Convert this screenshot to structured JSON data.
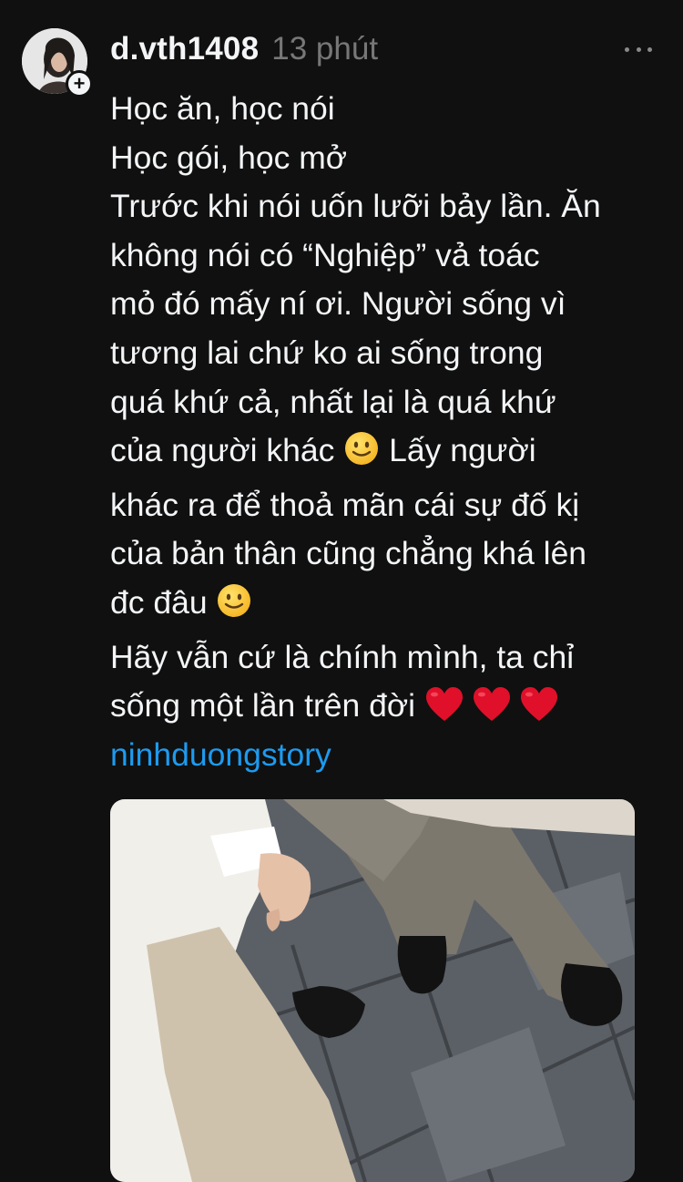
{
  "post": {
    "author": {
      "username": "d.vth1408",
      "timestamp": "13 phút",
      "follow_symbol": "+"
    },
    "text_lines": [
      "Học ăn, học nói",
      "Học gói, học mở",
      "Trước khi nói uốn lưỡi bảy lần. Ăn",
      "không nói có “Nghiệp” vả toác",
      "mỏ đó mấy ní ơi. Người sống vì",
      "tương lai chứ ko ai sống trong",
      "quá khứ cả, nhất lại là quá khứ"
    ],
    "line8_before": "của người khác ",
    "line8_after": " Lấy người",
    "line9": "khác ra để thoả mãn cái sự đố kị",
    "line10": "của bản thân cũng chẳng khá lên",
    "line11_before": "đc đâu ",
    "line12": "Hãy vẫn cứ là chính mình, ta chỉ",
    "line13_before": "sống một lần trên đời ",
    "tag": "ninhduongstory",
    "icons": {
      "emoji": "slightly-smiling-face-icon",
      "heart": "red-heart-icon",
      "more": "more-horizontal-icon"
    },
    "colors": {
      "background": "#101010",
      "text": "#f3f5f7",
      "secondary": "#777777",
      "link": "#1d9bf0",
      "heart": "#e0102a"
    }
  }
}
